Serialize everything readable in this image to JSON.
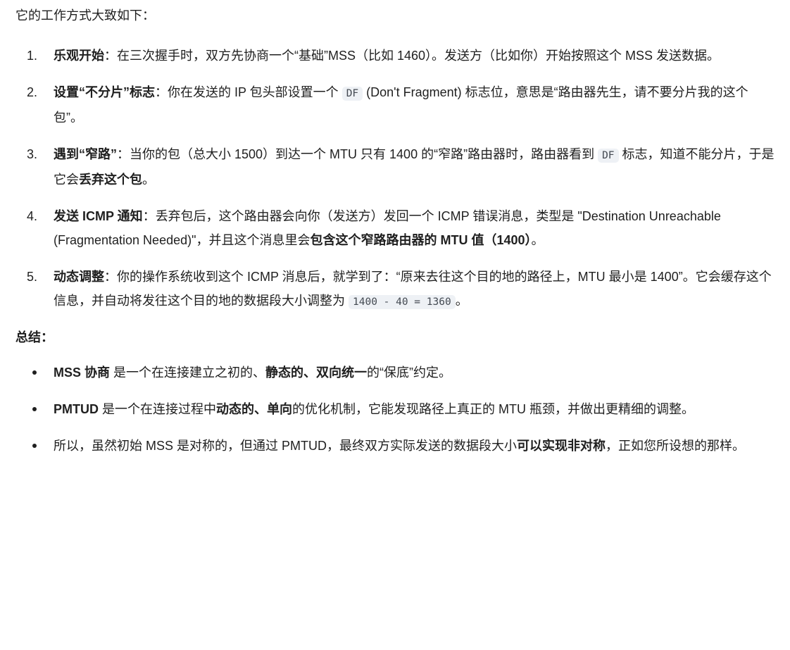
{
  "intro": "它的工作方式大致如下：",
  "steps": [
    {
      "num": "1.",
      "title": "乐观开始",
      "colon": "：",
      "t1": "在三次握手时，双方先协商一个“基础”MSS（比如 1460）。发送方（比如你）开始按照这个 MSS 发送数据。"
    },
    {
      "num": "2.",
      "title": "设置“不分片”标志",
      "colon": "：",
      "t1": "你在发送的 IP 包头部设置一个 ",
      "code": "DF",
      "t2": " (Don't Fragment) 标志位，意思是“路由器先生，请不要分片我的这个包”。"
    },
    {
      "num": "3.",
      "title": "遇到“窄路”",
      "colon": "：",
      "t1": "当你的包（总大小 1500）到达一个 MTU 只有 1400 的“窄路”路由器时，路由器看到 ",
      "code": "DF",
      "t2": " 标志，知道不能分片，于是它会",
      "bold2": "丢弃这个包",
      "t3": "。"
    },
    {
      "num": "4.",
      "title": "发送 ICMP 通知",
      "colon": "：",
      "t1": "丢弃包后，这个路由器会向你（发送方）发回一个 ICMP 错误消息，类型是 \"Destination Unreachable (Fragmentation Needed)\"，并且这个消息里会",
      "bold2": "包含这个窄路路由器的 MTU 值（1400）",
      "t2": "。"
    },
    {
      "num": "5.",
      "title": "动态调整",
      "colon": "：",
      "t1": "你的操作系统收到这个 ICMP 消息后，就学到了：“原来去往这个目的地的路径上，MTU 最小是 1400”。它会缓存这个信息，并自动将发往这个目的地的数据段大小调整为 ",
      "code": "1400 - 40 = 1360",
      "t2": "。"
    }
  ],
  "summary": {
    "title": "总结：",
    "items": [
      {
        "b1": "MSS 协商",
        "t1": " 是一个在连接建立之初的、",
        "b2": "静态的、双向统一",
        "t2": "的“保底”约定。"
      },
      {
        "b1": "PMTUD",
        "t1": " 是一个在连接过程中",
        "b2": "动态的、单向",
        "t2": "的优化机制，它能发现路径上真正的 MTU 瓶颈，并做出更精细的调整。"
      },
      {
        "t0": "所以，虽然初始 MSS 是对称的，但通过 PMTUD，最终双方实际发送的数据段大小",
        "b1": "可以实现非对称",
        "t1": "，正如您所设想的那样。"
      }
    ]
  }
}
